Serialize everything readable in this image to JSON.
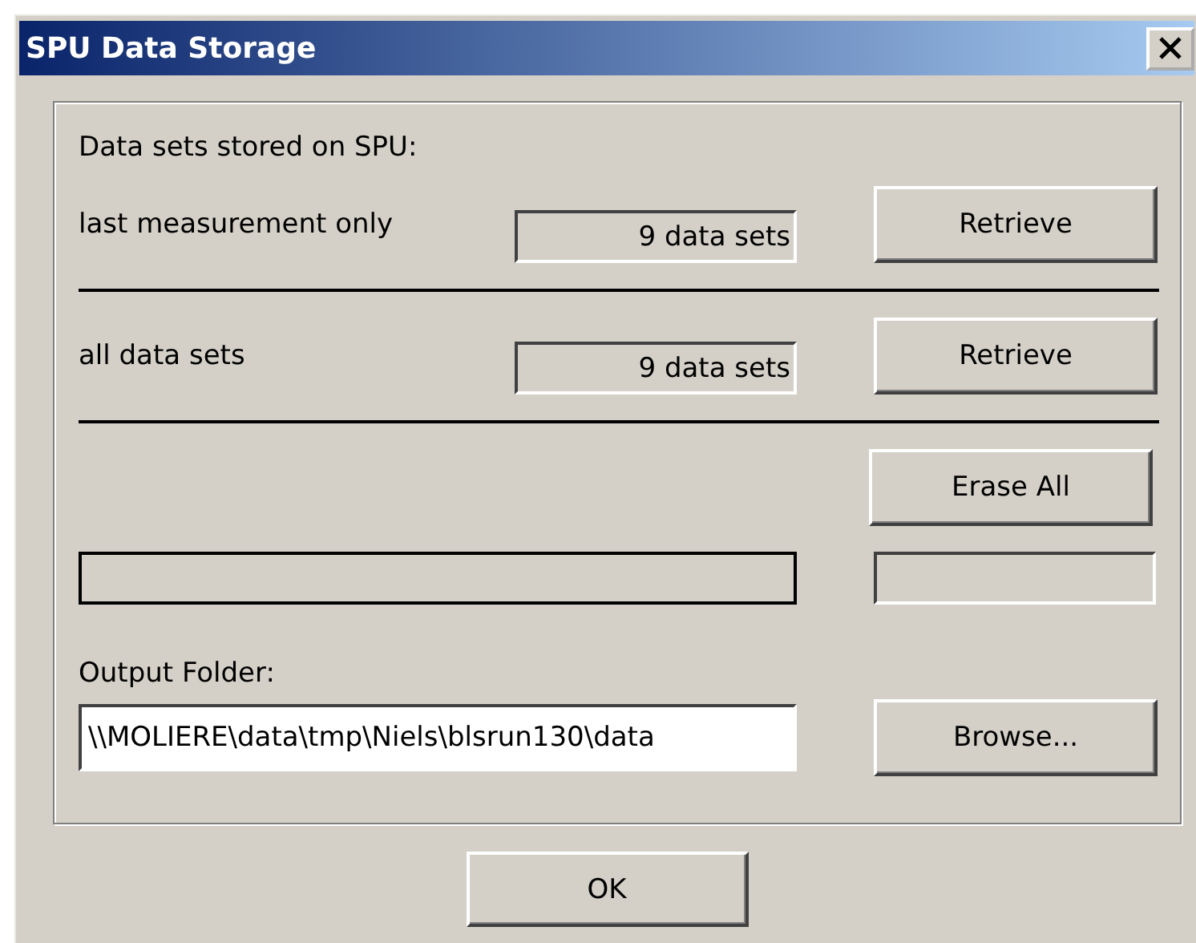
{
  "window": {
    "title": "SPU Data Storage"
  },
  "group": {
    "heading": "Data sets stored on SPU:",
    "rows": [
      {
        "label": "last measurement only",
        "count": "9 data sets",
        "button": "Retrieve"
      },
      {
        "label": "all data sets",
        "count": "9 data sets",
        "button": "Retrieve"
      }
    ],
    "erase_button": "Erase All",
    "progress": {
      "level": 0
    },
    "output_folder": {
      "label": "Output Folder:",
      "value": "\\\\MOLIERE\\data\\tmp\\Niels\\blsrun130\\data",
      "button": "Browse..."
    }
  },
  "ok_button": "OK"
}
